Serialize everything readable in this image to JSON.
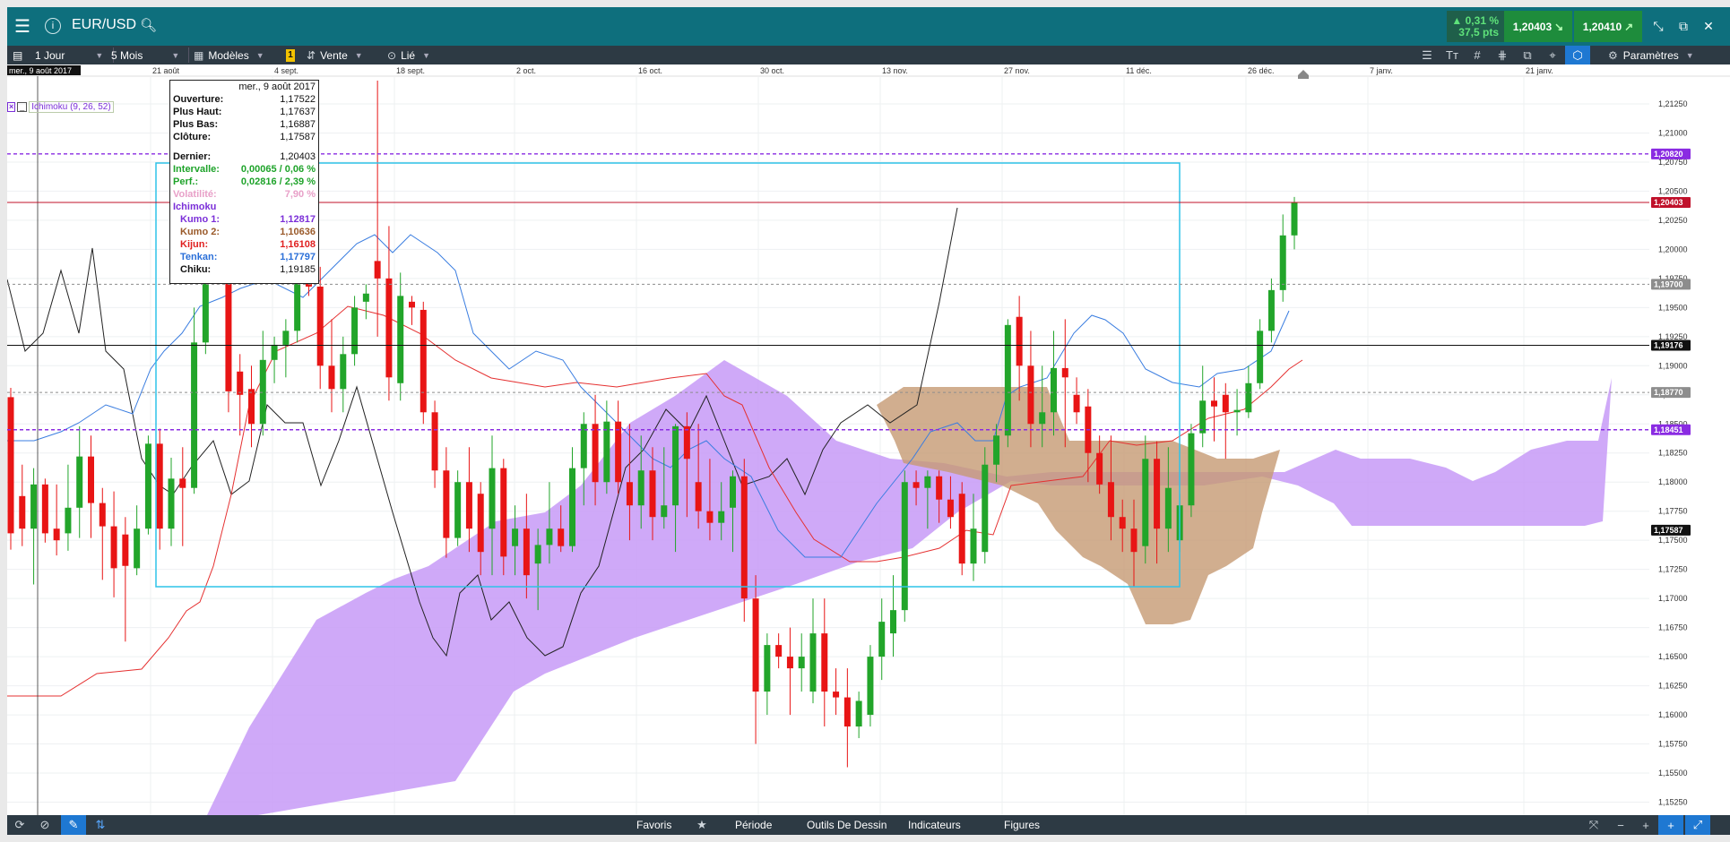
{
  "app": {
    "instrument": "EUR/USD",
    "info_glyph": "i"
  },
  "quotes": {
    "change_pct": "▲ 0,31 %",
    "change_pts": "37,5 pts",
    "bid": "1,20403",
    "ask": "1,20410",
    "bid_arrow": "↘",
    "ask_arrow": "↗"
  },
  "toolbar": {
    "interval": "1 Jour",
    "period": "5 Mois",
    "templates": "Modèles",
    "badge": "1",
    "order": "Vente",
    "linked": "Lié",
    "settings": "Paramètres"
  },
  "bottombar": {
    "favorites": "Favoris",
    "period": "Période",
    "drawing_tools": "Outils De Dessin",
    "indicators": "Indicateurs",
    "figures": "Figures"
  },
  "indicator_label": "Ichimoku (9, 26, 52)",
  "tooltip": {
    "date": "mer., 9 août 2017",
    "rows": [
      {
        "label": "Ouverture:",
        "value": "1,17522",
        "color": "#111111"
      },
      {
        "label": "Plus Haut:",
        "value": "1,17637",
        "color": "#111111"
      },
      {
        "label": "Plus Bas:",
        "value": "1,16887",
        "color": "#111111"
      },
      {
        "label": "Clôture:",
        "value": "1,17587",
        "color": "#111111"
      }
    ],
    "rows2": [
      {
        "label": "Dernier:",
        "value": "1,20403",
        "color": "#111111"
      },
      {
        "label": "Intervalle:",
        "value": "0,00065 / 0,06 %",
        "color": "#1ea32a"
      },
      {
        "label": "Perf.:",
        "value": "0,02816 / 2,39 %",
        "color": "#1ea32a"
      },
      {
        "label": "Volatilité:",
        "value": "7,90 %",
        "color": "#e8a0c8"
      }
    ],
    "ichimoku_title": "Ichimoku",
    "ichimoku_rows": [
      {
        "label": "Kumo 1:",
        "value": "1,12817",
        "color": "#7b2fd8"
      },
      {
        "label": "Kumo 2:",
        "value": "1,10636",
        "color": "#9a5a2a"
      },
      {
        "label": "Kijun:",
        "value": "1,16108",
        "color": "#e02020"
      },
      {
        "label": "Tenkan:",
        "value": "1,17797",
        "color": "#2a6fd8"
      },
      {
        "label": "Chiku:",
        "value": "1,19185",
        "color": "#111111"
      }
    ]
  },
  "chart_data": {
    "type": "candlestick",
    "x_tick_labels": [
      "mer., 9 août 2017",
      "21 août",
      "4 sept.",
      "18 sept.",
      "2 oct.",
      "16 oct.",
      "30 oct.",
      "13 nov.",
      "27 nov.",
      "11 déc.",
      "26 déc.",
      "7 janv.",
      "21 janv."
    ],
    "y_tick_labels": [
      "1,21250",
      "1,21000",
      "1,20750",
      "1,20500",
      "1,20250",
      "1,20000",
      "1,19750",
      "1,19500",
      "1,19250",
      "1,19000",
      "1,18750",
      "1,18500",
      "1,18250",
      "1,18000",
      "1,17750",
      "1,17500",
      "1,17250",
      "1,17000",
      "1,16750",
      "1,16500",
      "1,16250",
      "1,16000",
      "1,15750",
      "1,15500",
      "1,15250"
    ],
    "ylim": [
      1.152,
      1.2145
    ],
    "price_tags": [
      {
        "value": 1.20403,
        "label": "1,20403",
        "color": "#c0102a"
      },
      {
        "value": 1.19176,
        "label": "1,19176",
        "color": "#111111"
      },
      {
        "value": 1.17587,
        "label": "1,17587",
        "color": "#111111"
      },
      {
        "value": 1.197,
        "label": "1,19700",
        "color": "#8d8d8d"
      },
      {
        "value": 1.1877,
        "label": "1,18770",
        "color": "#8d8d8d"
      },
      {
        "value": 1.2082,
        "label": "1,20820",
        "color": "#8a2be2"
      },
      {
        "value": 1.1845,
        "label": "1,18451",
        "color": "#8a2be2"
      }
    ],
    "candles": [
      {
        "o": 1.1873,
        "h": 1.1881,
        "l": 1.1742,
        "c": 1.1756
      },
      {
        "o": 1.1788,
        "h": 1.1815,
        "l": 1.1745,
        "c": 1.176
      },
      {
        "o": 1.176,
        "h": 1.1812,
        "l": 1.1712,
        "c": 1.1798
      },
      {
        "o": 1.1798,
        "h": 1.1803,
        "l": 1.1748,
        "c": 1.1756
      },
      {
        "o": 1.176,
        "h": 1.1798,
        "l": 1.1737,
        "c": 1.175
      },
      {
        "o": 1.1756,
        "h": 1.1815,
        "l": 1.1741,
        "c": 1.1778
      },
      {
        "o": 1.1778,
        "h": 1.1848,
        "l": 1.1752,
        "c": 1.1822
      },
      {
        "o": 1.1822,
        "h": 1.184,
        "l": 1.1752,
        "c": 1.1782
      },
      {
        "o": 1.1782,
        "h": 1.1795,
        "l": 1.1716,
        "c": 1.1762
      },
      {
        "o": 1.1762,
        "h": 1.1792,
        "l": 1.1701,
        "c": 1.1726
      },
      {
        "o": 1.1755,
        "h": 1.177,
        "l": 1.1663,
        "c": 1.1728
      },
      {
        "o": 1.1726,
        "h": 1.178,
        "l": 1.172,
        "c": 1.176
      },
      {
        "o": 1.176,
        "h": 1.184,
        "l": 1.1755,
        "c": 1.1833
      },
      {
        "o": 1.1833,
        "h": 1.1846,
        "l": 1.1742,
        "c": 1.176
      },
      {
        "o": 1.176,
        "h": 1.1821,
        "l": 1.1745,
        "c": 1.1803
      },
      {
        "o": 1.1803,
        "h": 1.183,
        "l": 1.1745,
        "c": 1.1795
      },
      {
        "o": 1.1795,
        "h": 1.195,
        "l": 1.179,
        "c": 1.192
      },
      {
        "o": 1.192,
        "h": 1.208,
        "l": 1.191,
        "c": 1.2065
      },
      {
        "o": 1.204,
        "h": 1.209,
        "l": 1.197,
        "c": 1.1995
      },
      {
        "o": 1.1995,
        "h": 1.201,
        "l": 1.186,
        "c": 1.1878
      },
      {
        "o": 1.1895,
        "h": 1.191,
        "l": 1.184,
        "c": 1.1875
      },
      {
        "o": 1.188,
        "h": 1.19,
        "l": 1.183,
        "c": 1.185
      },
      {
        "o": 1.185,
        "h": 1.193,
        "l": 1.184,
        "c": 1.1905
      },
      {
        "o": 1.1905,
        "h": 1.1925,
        "l": 1.1885,
        "c": 1.1918
      },
      {
        "o": 1.1918,
        "h": 1.194,
        "l": 1.189,
        "c": 1.193
      },
      {
        "o": 1.193,
        "h": 1.205,
        "l": 1.192,
        "c": 1.202
      },
      {
        "o": 1.202,
        "h": 1.2065,
        "l": 1.196,
        "c": 1.1968
      },
      {
        "o": 1.1968,
        "h": 1.1985,
        "l": 1.188,
        "c": 1.19
      },
      {
        "o": 1.19,
        "h": 1.194,
        "l": 1.186,
        "c": 1.188
      },
      {
        "o": 1.188,
        "h": 1.1925,
        "l": 1.186,
        "c": 1.191
      },
      {
        "o": 1.191,
        "h": 1.196,
        "l": 1.19,
        "c": 1.195
      },
      {
        "o": 1.1955,
        "h": 1.197,
        "l": 1.194,
        "c": 1.1962
      },
      {
        "o": 1.199,
        "h": 2.0,
        "l": 1.1925,
        "c": 1.1975
      },
      {
        "o": 1.1975,
        "h": 1.202,
        "l": 1.187,
        "c": 1.189
      },
      {
        "o": 1.1885,
        "h": 1.198,
        "l": 1.187,
        "c": 1.196
      },
      {
        "o": 1.1955,
        "h": 1.196,
        "l": 1.1935,
        "c": 1.195
      },
      {
        "o": 1.1948,
        "h": 1.1955,
        "l": 1.185,
        "c": 1.186
      },
      {
        "o": 1.186,
        "h": 1.187,
        "l": 1.1795,
        "c": 1.181
      },
      {
        "o": 1.181,
        "h": 1.183,
        "l": 1.1735,
        "c": 1.1752
      },
      {
        "o": 1.1752,
        "h": 1.181,
        "l": 1.1745,
        "c": 1.18
      },
      {
        "o": 1.18,
        "h": 1.183,
        "l": 1.174,
        "c": 1.176
      },
      {
        "o": 1.179,
        "h": 1.18,
        "l": 1.172,
        "c": 1.174
      },
      {
        "o": 1.176,
        "h": 1.184,
        "l": 1.172,
        "c": 1.1812
      },
      {
        "o": 1.1812,
        "h": 1.182,
        "l": 1.172,
        "c": 1.1736
      },
      {
        "o": 1.1745,
        "h": 1.178,
        "l": 1.172,
        "c": 1.176
      },
      {
        "o": 1.176,
        "h": 1.179,
        "l": 1.17,
        "c": 1.172
      },
      {
        "o": 1.173,
        "h": 1.176,
        "l": 1.169,
        "c": 1.1746
      },
      {
        "o": 1.1746,
        "h": 1.18,
        "l": 1.173,
        "c": 1.176
      },
      {
        "o": 1.176,
        "h": 1.178,
        "l": 1.174,
        "c": 1.1745
      },
      {
        "o": 1.1745,
        "h": 1.183,
        "l": 1.174,
        "c": 1.1812
      },
      {
        "o": 1.1812,
        "h": 1.186,
        "l": 1.178,
        "c": 1.185
      },
      {
        "o": 1.185,
        "h": 1.1875,
        "l": 1.178,
        "c": 1.18
      },
      {
        "o": 1.18,
        "h": 1.187,
        "l": 1.179,
        "c": 1.1852
      },
      {
        "o": 1.1852,
        "h": 1.187,
        "l": 1.179,
        "c": 1.18
      },
      {
        "o": 1.18,
        "h": 1.185,
        "l": 1.175,
        "c": 1.178
      },
      {
        "o": 1.178,
        "h": 1.184,
        "l": 1.176,
        "c": 1.181
      },
      {
        "o": 1.181,
        "h": 1.183,
        "l": 1.175,
        "c": 1.177
      },
      {
        "o": 1.177,
        "h": 1.183,
        "l": 1.176,
        "c": 1.178
      },
      {
        "o": 1.178,
        "h": 1.185,
        "l": 1.174,
        "c": 1.1848
      },
      {
        "o": 1.1848,
        "h": 1.186,
        "l": 1.177,
        "c": 1.182
      },
      {
        "o": 1.18,
        "h": 1.185,
        "l": 1.176,
        "c": 1.1775
      },
      {
        "o": 1.1775,
        "h": 1.182,
        "l": 1.175,
        "c": 1.1765
      },
      {
        "o": 1.1765,
        "h": 1.18,
        "l": 1.175,
        "c": 1.1775
      },
      {
        "o": 1.1778,
        "h": 1.181,
        "l": 1.174,
        "c": 1.1805
      },
      {
        "o": 1.1805,
        "h": 1.182,
        "l": 1.168,
        "c": 1.17
      },
      {
        "o": 1.17,
        "h": 1.172,
        "l": 1.1575,
        "c": 1.162
      },
      {
        "o": 1.162,
        "h": 1.167,
        "l": 1.16,
        "c": 1.166
      },
      {
        "o": 1.166,
        "h": 1.167,
        "l": 1.164,
        "c": 1.165
      },
      {
        "o": 1.165,
        "h": 1.1675,
        "l": 1.16,
        "c": 1.164
      },
      {
        "o": 1.164,
        "h": 1.167,
        "l": 1.162,
        "c": 1.165
      },
      {
        "o": 1.162,
        "h": 1.17,
        "l": 1.161,
        "c": 1.167
      },
      {
        "o": 1.167,
        "h": 1.17,
        "l": 1.159,
        "c": 1.162
      },
      {
        "o": 1.162,
        "h": 1.164,
        "l": 1.16,
        "c": 1.1615
      },
      {
        "o": 1.1615,
        "h": 1.164,
        "l": 1.1555,
        "c": 1.159
      },
      {
        "o": 1.159,
        "h": 1.162,
        "l": 1.158,
        "c": 1.1612
      },
      {
        "o": 1.16,
        "h": 1.166,
        "l": 1.159,
        "c": 1.165
      },
      {
        "o": 1.165,
        "h": 1.17,
        "l": 1.163,
        "c": 1.168
      },
      {
        "o": 1.167,
        "h": 1.172,
        "l": 1.165,
        "c": 1.169
      },
      {
        "o": 1.169,
        "h": 1.181,
        "l": 1.168,
        "c": 1.18
      },
      {
        "o": 1.18,
        "h": 1.181,
        "l": 1.178,
        "c": 1.1795
      },
      {
        "o": 1.1795,
        "h": 1.181,
        "l": 1.176,
        "c": 1.1805
      },
      {
        "o": 1.1805,
        "h": 1.181,
        "l": 1.1765,
        "c": 1.1785
      },
      {
        "o": 1.1785,
        "h": 1.1805,
        "l": 1.176,
        "c": 1.177
      },
      {
        "o": 1.179,
        "h": 1.18,
        "l": 1.172,
        "c": 1.173
      },
      {
        "o": 1.173,
        "h": 1.179,
        "l": 1.1715,
        "c": 1.176
      },
      {
        "o": 1.174,
        "h": 1.183,
        "l": 1.173,
        "c": 1.1815
      },
      {
        "o": 1.1815,
        "h": 1.185,
        "l": 1.18,
        "c": 1.184
      },
      {
        "o": 1.184,
        "h": 1.194,
        "l": 1.183,
        "c": 1.1935
      },
      {
        "o": 1.1942,
        "h": 1.196,
        "l": 1.187,
        "c": 1.19
      },
      {
        "o": 1.19,
        "h": 1.193,
        "l": 1.183,
        "c": 1.185
      },
      {
        "o": 1.185,
        "h": 1.19,
        "l": 1.183,
        "c": 1.186
      },
      {
        "o": 1.186,
        "h": 1.193,
        "l": 1.184,
        "c": 1.1898
      },
      {
        "o": 1.1898,
        "h": 1.194,
        "l": 1.183,
        "c": 1.189
      },
      {
        "o": 1.1875,
        "h": 1.189,
        "l": 1.185,
        "c": 1.186
      },
      {
        "o": 1.1865,
        "h": 1.188,
        "l": 1.18,
        "c": 1.1825
      },
      {
        "o": 1.1825,
        "h": 1.184,
        "l": 1.179,
        "c": 1.1798
      },
      {
        "o": 1.18,
        "h": 1.184,
        "l": 1.175,
        "c": 1.177
      },
      {
        "o": 1.177,
        "h": 1.1785,
        "l": 1.174,
        "c": 1.176
      },
      {
        "o": 1.176,
        "h": 1.1785,
        "l": 1.171,
        "c": 1.174
      },
      {
        "o": 1.1745,
        "h": 1.184,
        "l": 1.173,
        "c": 1.182
      },
      {
        "o": 1.182,
        "h": 1.1835,
        "l": 1.173,
        "c": 1.176
      },
      {
        "o": 1.176,
        "h": 1.183,
        "l": 1.174,
        "c": 1.1795
      },
      {
        "o": 1.175,
        "h": 1.179,
        "l": 1.174,
        "c": 1.178
      },
      {
        "o": 1.178,
        "h": 1.185,
        "l": 1.177,
        "c": 1.1842
      },
      {
        "o": 1.1842,
        "h": 1.19,
        "l": 1.183,
        "c": 1.187
      },
      {
        "o": 1.187,
        "h": 1.189,
        "l": 1.1835,
        "c": 1.1865
      },
      {
        "o": 1.1875,
        "h": 1.1885,
        "l": 1.182,
        "c": 1.186
      },
      {
        "o": 1.186,
        "h": 1.188,
        "l": 1.184,
        "c": 1.1862
      },
      {
        "o": 1.186,
        "h": 1.19,
        "l": 1.1855,
        "c": 1.1885
      },
      {
        "o": 1.1885,
        "h": 1.194,
        "l": 1.188,
        "c": 1.193
      },
      {
        "o": 1.193,
        "h": 1.1975,
        "l": 1.192,
        "c": 1.1965
      },
      {
        "o": 1.1965,
        "h": 1.203,
        "l": 1.1955,
        "c": 1.2012
      },
      {
        "o": 1.2012,
        "h": 1.2045,
        "l": 1.2,
        "c": 1.204
      }
    ]
  }
}
